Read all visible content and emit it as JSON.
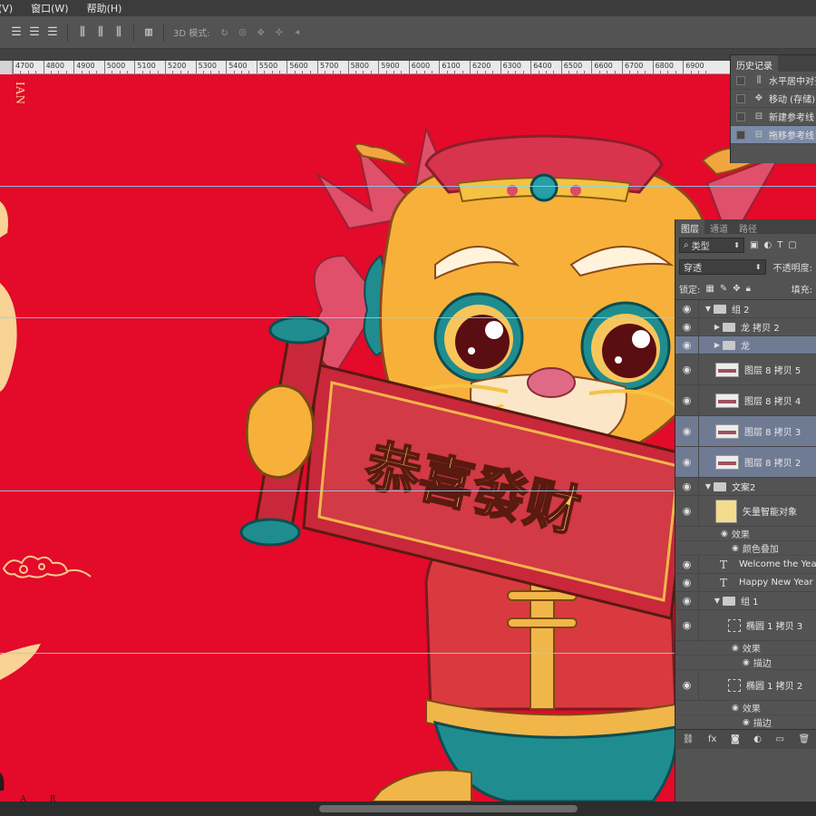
{
  "menubar": {
    "items": [
      "(V)",
      "窗口(W)",
      "帮助(H)"
    ]
  },
  "optbar": {
    "align_icons": [
      "align-top-icon",
      "align-vcenter-icon",
      "align-bottom-icon",
      "align-left-icon",
      "align-hcenter-icon",
      "align-right-icon",
      "distribute-icon"
    ],
    "mode3d_label": "3D 模式:"
  },
  "ruler": {
    "labels": [
      "4700",
      "4800",
      "4900",
      "5000",
      "5100",
      "5200",
      "5300",
      "5400",
      "5500",
      "5600",
      "5700",
      "5800",
      "5900",
      "6000",
      "6100",
      "6200",
      "6300",
      "6400",
      "6500",
      "6600",
      "6700",
      "6800",
      "6900"
    ]
  },
  "canvas": {
    "background": "#e30a2a",
    "vertical_text": "IAN",
    "scroll_text": "恭喜發财",
    "bottom_letters": [
      "A",
      "R"
    ]
  },
  "history": {
    "tab": "历史记录",
    "items": [
      {
        "label": "水平居中对齐",
        "icon": "align-icon",
        "selected": false
      },
      {
        "label": "移动 (存储)",
        "icon": "move-icon",
        "selected": false
      },
      {
        "label": "新建参考线",
        "icon": "guide-icon",
        "selected": false
      },
      {
        "label": "拖移参考线",
        "icon": "guide-icon",
        "selected": true
      }
    ]
  },
  "layers": {
    "tabs": [
      "图层",
      "通道",
      "路径"
    ],
    "filter_label": "类型",
    "blend_mode": "穿透",
    "opacity_label": "不透明度:",
    "lock_label": "锁定:",
    "fill_label": "填充:",
    "rows": [
      {
        "name": "组 2",
        "kind": "group-open",
        "indent": 0,
        "selected": false
      },
      {
        "name": "龙 拷贝 2",
        "kind": "group-closed",
        "indent": 1,
        "selected": false
      },
      {
        "name": "龙",
        "kind": "group-closed",
        "indent": 1,
        "selected": true
      },
      {
        "name": "图层 8 拷贝 5",
        "kind": "pixel",
        "indent": 1,
        "selected": false
      },
      {
        "name": "图层 8 拷贝 4",
        "kind": "pixel",
        "indent": 1,
        "selected": false
      },
      {
        "name": "图层 8 拷贝 3",
        "kind": "pixel",
        "indent": 1,
        "selected": true
      },
      {
        "name": "图层 8 拷贝 2",
        "kind": "pixel",
        "indent": 1,
        "selected": true
      },
      {
        "name": "文案2",
        "kind": "group-open",
        "indent": 0,
        "selected": false
      },
      {
        "name": "矢量智能对象",
        "kind": "smart",
        "indent": 1,
        "selected": false
      },
      {
        "name": "效果",
        "kind": "fx",
        "indent": 2
      },
      {
        "name": "颜色叠加",
        "kind": "fx",
        "indent": 3
      },
      {
        "name": "Welcome the Year",
        "kind": "text",
        "indent": 1,
        "selected": false
      },
      {
        "name": "Happy New Year",
        "kind": "text",
        "indent": 1,
        "selected": false
      },
      {
        "name": "组 1",
        "kind": "group-open",
        "indent": 1,
        "selected": false
      },
      {
        "name": "椭圆 1 拷贝 3",
        "kind": "shape",
        "indent": 2,
        "selected": false
      },
      {
        "name": "效果",
        "kind": "fx",
        "indent": 3
      },
      {
        "name": "描边",
        "kind": "fx",
        "indent": 4
      },
      {
        "name": "椭圆 1 拷贝 2",
        "kind": "shape",
        "indent": 2,
        "selected": false
      },
      {
        "name": "效果",
        "kind": "fx",
        "indent": 3
      },
      {
        "name": "描边",
        "kind": "fx",
        "indent": 4
      }
    ],
    "footer_icons": [
      "link-icon",
      "fx-icon",
      "mask-icon",
      "adjustment-icon",
      "folder-icon",
      "trash-icon"
    ]
  }
}
